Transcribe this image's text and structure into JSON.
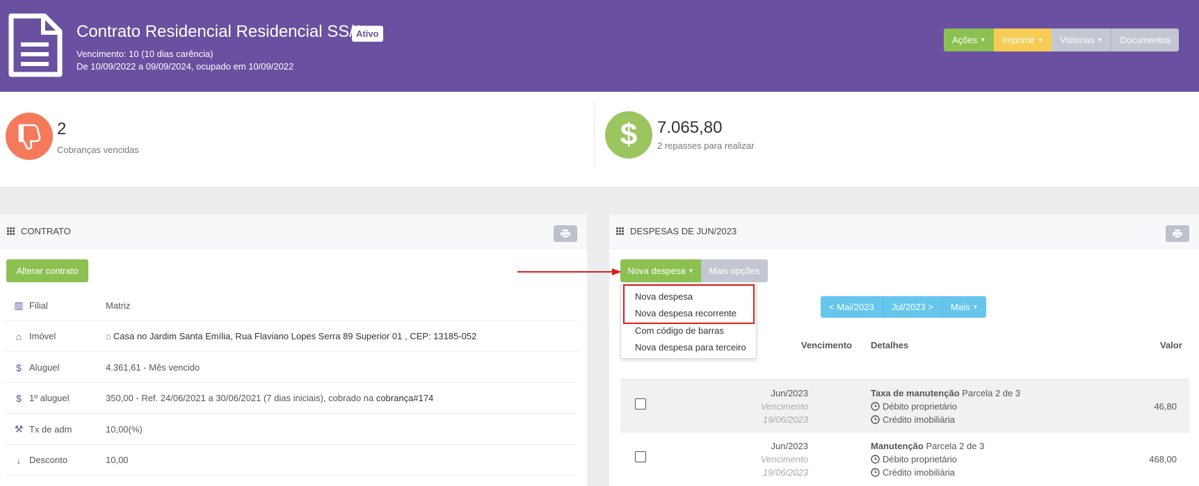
{
  "header": {
    "title": "Contrato Residencial Residencial SS/1",
    "status": "Ativo",
    "vencimento": "Vencimento: 10 (10 dias carência)",
    "periodo": "De 10/09/2022 a 09/09/2024, ocupado em 10/09/2022",
    "buttons": {
      "acoes": "Ações",
      "imprimir": "Imprimir",
      "vistorias": "Vistorias",
      "documentos": "Documentos"
    }
  },
  "stats": {
    "vencidas": {
      "value": "2",
      "label": "Cobranças vencidas"
    },
    "repasses": {
      "value": "7.065,80",
      "label": "2 repasses para realizar",
      "symbol": "$"
    }
  },
  "contrato": {
    "title": "CONTRATO",
    "alterar_label": "Alterar contrato",
    "rows": [
      {
        "label": "Filial",
        "value": "Matriz"
      },
      {
        "label": "Imóvel",
        "value": "Casa no Jardim Santa Emília, Rua Flaviano Lopes Serra 89 Superior 01 , CEP: 13185-052"
      },
      {
        "label": "Aluguel",
        "value": "4.361,61 - Mês vencido"
      },
      {
        "label": "1º aluguel",
        "value": "350,00 - Ref. 24/06/2021 a 30/06/2021 (7 dias iniciais), cobrado na ",
        "link": "cobrança#174"
      },
      {
        "label": "Tx de adm",
        "value": "10,00(%)"
      },
      {
        "label": "Desconto",
        "value": "10,00"
      }
    ]
  },
  "despesas": {
    "title": "DESPESAS DE JUN/2023",
    "nova_despesa_label": "Nova despesa",
    "mais_opcoes_label": "Mais opções",
    "dropdown": [
      "Nova despesa",
      "Nova despesa recorrente",
      "Com código de barras",
      "Nova despesa para terceiro"
    ],
    "pager": {
      "prev": "< Mai/2023",
      "next": "Jul/2023 >",
      "mais": "Mais"
    },
    "columns": {
      "vencimento": "Vencimento",
      "detalhes": "Detalhes",
      "valor": "Valor"
    },
    "rows": [
      {
        "mes": "Jun/2023",
        "venc_label": "Vencimento",
        "data": "19/06/2023",
        "titulo": "Taxa de manutenção",
        "parcela": "Parcela 2 de 3",
        "debito": "Débito proprietário",
        "credito": "Crédito imobiliária",
        "valor": "46,80"
      },
      {
        "mes": "Jun/2023",
        "venc_label": "Vencimento",
        "data": "19/06/2023",
        "titulo": "Manutenção",
        "parcela": "Parcela 2 de 3",
        "debito": "Débito proprietário",
        "credito": "Crédito imobiliária",
        "valor": "468,00"
      }
    ]
  },
  "colors": {
    "header": "#6a50a0",
    "green": "#8cc152",
    "yellow": "#f6cc55",
    "grey_btn": "#c3c7d1",
    "blue": "#66c6ec",
    "red_stat": "#f5795b",
    "green_stat": "#9bc55f",
    "highlight": "#e21b1b"
  }
}
